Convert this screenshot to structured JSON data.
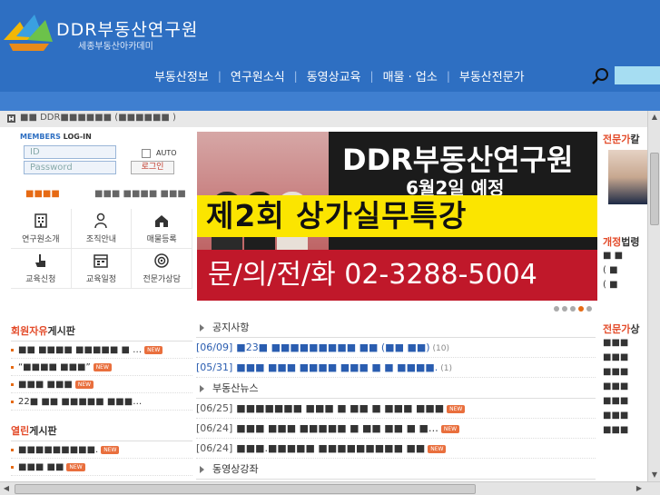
{
  "header": {
    "title": "DDR부동산연구원",
    "subtitle": "세종부동산아카데미",
    "nav": [
      "부동산정보",
      "연구원소식",
      "동영상교육",
      "매물 · 업소",
      "부동산전문가"
    ]
  },
  "topbar": {
    "text": "■■ DDR■■■■■■ (■■■■■■ )"
  },
  "login": {
    "title_a": "MEMBERS",
    "title_b": " LOG-IN",
    "id_placeholder": "ID",
    "pw_placeholder": "Password",
    "auto_label": "AUTO",
    "login_button": "로그인"
  },
  "tabs": {
    "a": "■■■■",
    "b": "■■■ ■■■■ ■■■"
  },
  "quick": [
    {
      "icon": "building-icon",
      "label": "연구원소개"
    },
    {
      "icon": "person-icon",
      "label": "조직안내"
    },
    {
      "icon": "house-icon",
      "label": "매물등록"
    },
    {
      "icon": "pointer-icon",
      "label": "교육신청"
    },
    {
      "icon": "calendar-icon",
      "label": "교육일정"
    },
    {
      "icon": "target-icon",
      "label": "전문가상담"
    }
  ],
  "board_free": {
    "title_a": "회원자유",
    "title_b": "게시판",
    "rows": [
      {
        "text": "■■ ■■■■ ■■■■■ ■ …",
        "new": true
      },
      {
        "text": "“■■■■ ■■■”",
        "new": true
      },
      {
        "text": "■■■ ■■■",
        "new": true
      },
      {
        "text": "22■ ■■ ■■■■■ ■■■…",
        "new": false
      }
    ]
  },
  "board_open": {
    "title_a": "열린",
    "title_b": "게시판",
    "rows": [
      {
        "text": "■■■■■■■■■.",
        "new": true
      },
      {
        "text": "■■■ ■■",
        "new": true
      }
    ]
  },
  "banner": {
    "line1": "DDR부동산연구원",
    "line2": "6월2일 예정",
    "main": "제2회 상가실무특강",
    "phone": "문/의/전/화 02-3288-5004"
  },
  "notice": {
    "title": "공지사항",
    "rows": [
      {
        "date": "[06/09]",
        "text": "■23■ ■■■■■■■■■ ■■ (■■ ■■)",
        "count": "(10)",
        "blue": true,
        "new": false
      },
      {
        "date": "[05/31]",
        "text": "■■■ ■■■ ■■■■ ■■■ ■ ■ ■■■■.",
        "count": "(1)",
        "blue": true,
        "new": false
      }
    ]
  },
  "news": {
    "title": "부동산뉴스",
    "rows": [
      {
        "date": "[06/25]",
        "text": "■■■■■■■ ■■■ ■ ■■ ■ ■■■ ■■■",
        "count": "",
        "blue": false,
        "new": true
      },
      {
        "date": "[06/24]",
        "text": "■■■ ■■■ ■■■■■ ■ ■■ ■■ ■ ■…",
        "count": "",
        "blue": false,
        "new": true
      },
      {
        "date": "[06/24]",
        "text": "■■■.■■■■■ ■■■■■■■■■ ■■",
        "count": "",
        "blue": false,
        "new": true
      }
    ]
  },
  "video": {
    "title": "동영상강좌"
  },
  "right": {
    "expert_a": "전문가",
    "expert_b": "칼",
    "open_a": "개정",
    "open_b": "법령",
    "consult_a": "전문가",
    "consult_b": "상",
    "rows_a": [
      "■ ■",
      "( ■",
      "( ■"
    ],
    "rows_b": [
      "■■■",
      "■■■",
      "■■■",
      "■■■",
      "■■■",
      "■■■",
      "■■■"
    ]
  },
  "badge_new": "NEW",
  "colors": {
    "header": "#2e6fc2",
    "accent": "#e66a14",
    "banner_yellow": "#fbe500",
    "banner_red": "#c0182a"
  }
}
